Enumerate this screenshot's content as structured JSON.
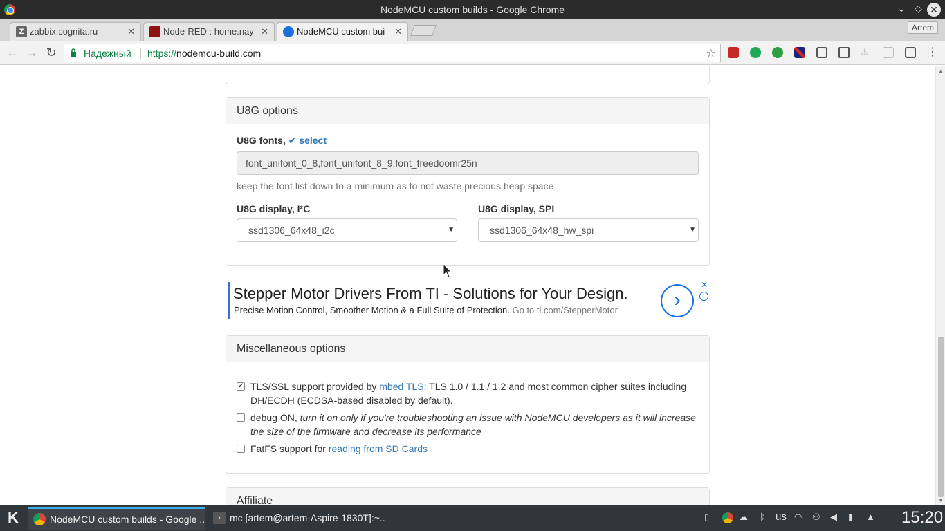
{
  "window": {
    "title": "NodeMCU custom builds - Google Chrome"
  },
  "tabs": [
    {
      "label": "zabbix.cognita.ru"
    },
    {
      "label": "Node-RED : home.nay"
    },
    {
      "label": "NodeMCU custom bui"
    }
  ],
  "profile": {
    "name": "Artem"
  },
  "address": {
    "secure_label": "Надежный",
    "url_proto": "https://",
    "url_host": "nodemcu-build.com"
  },
  "u8g": {
    "heading": "U8G options",
    "fonts_label": "U8G fonts,",
    "fonts_select": "✔ select",
    "fonts_value": "font_unifont_0_8,font_unifont_8_9,font_freedoomr25n",
    "fonts_help": "keep the font list down to a minimum as to not waste precious heap space",
    "i2c_label": "U8G display, I²C",
    "i2c_value": "ssd1306_64x48_i2c",
    "spi_label": "U8G display, SPI",
    "spi_value": "ssd1306_64x48_hw_spi"
  },
  "ad": {
    "headline": "Stepper Motor Drivers From TI - Solutions for Your Design.",
    "desc": "Precise Motion Control, Smoother Motion & a Full Suite of Protection.",
    "link": "Go to ti.com/StepperMotor"
  },
  "misc": {
    "heading": "Miscellaneous options",
    "tls_pre": "TLS/SSL support provided by",
    "tls_link": "mbed TLS",
    "tls_post": ": TLS 1.0 / 1.1 / 1.2 and most common cipher suites including DH/ECDH (ECDSA-based disabled by default).",
    "tls_checked": true,
    "debug_label": "debug ON,",
    "debug_note": "turn it on only if you're troubleshooting an issue with NodeMCU developers as it will increase the size of the firmware and decrease its performance",
    "fatfs_pre": "FatFS support for",
    "fatfs_link": "reading from SD Cards"
  },
  "affiliate": {
    "heading": "Affiliate"
  },
  "taskbar": {
    "tasks": [
      {
        "label": "NodeMCU custom builds - Google ..."
      },
      {
        "label": "mc [artem@artem-Aspire-1830T]:~..."
      }
    ],
    "layout": "us",
    "clock": "15:20"
  }
}
